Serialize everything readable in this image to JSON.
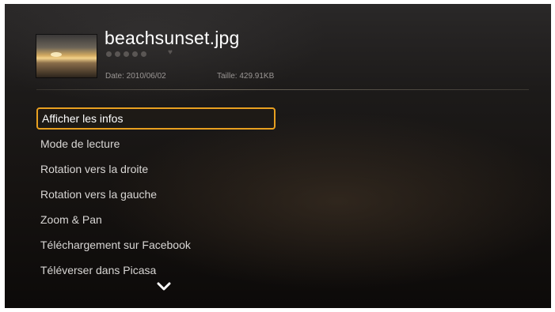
{
  "file": {
    "name": "beachsunset.jpg",
    "date": "Date: 2010/06/02",
    "size": "Taille: 429.91KB",
    "rating_stars": 0,
    "favorite": false
  },
  "menu": {
    "selected_index": 0,
    "items": [
      {
        "label": "Afficher les infos"
      },
      {
        "label": "Mode de lecture"
      },
      {
        "label": "Rotation vers la droite"
      },
      {
        "label": "Rotation vers la gauche"
      },
      {
        "label": "Zoom & Pan"
      },
      {
        "label": "Téléchargement sur Facebook"
      },
      {
        "label": "Téléverser dans Picasa"
      }
    ]
  },
  "colors": {
    "highlight": "#e8a020",
    "text": "#d8d6d4",
    "meta": "#9a9694"
  },
  "icons": {
    "more_below": "chevron-down-icon",
    "favorite": "heart-icon"
  }
}
